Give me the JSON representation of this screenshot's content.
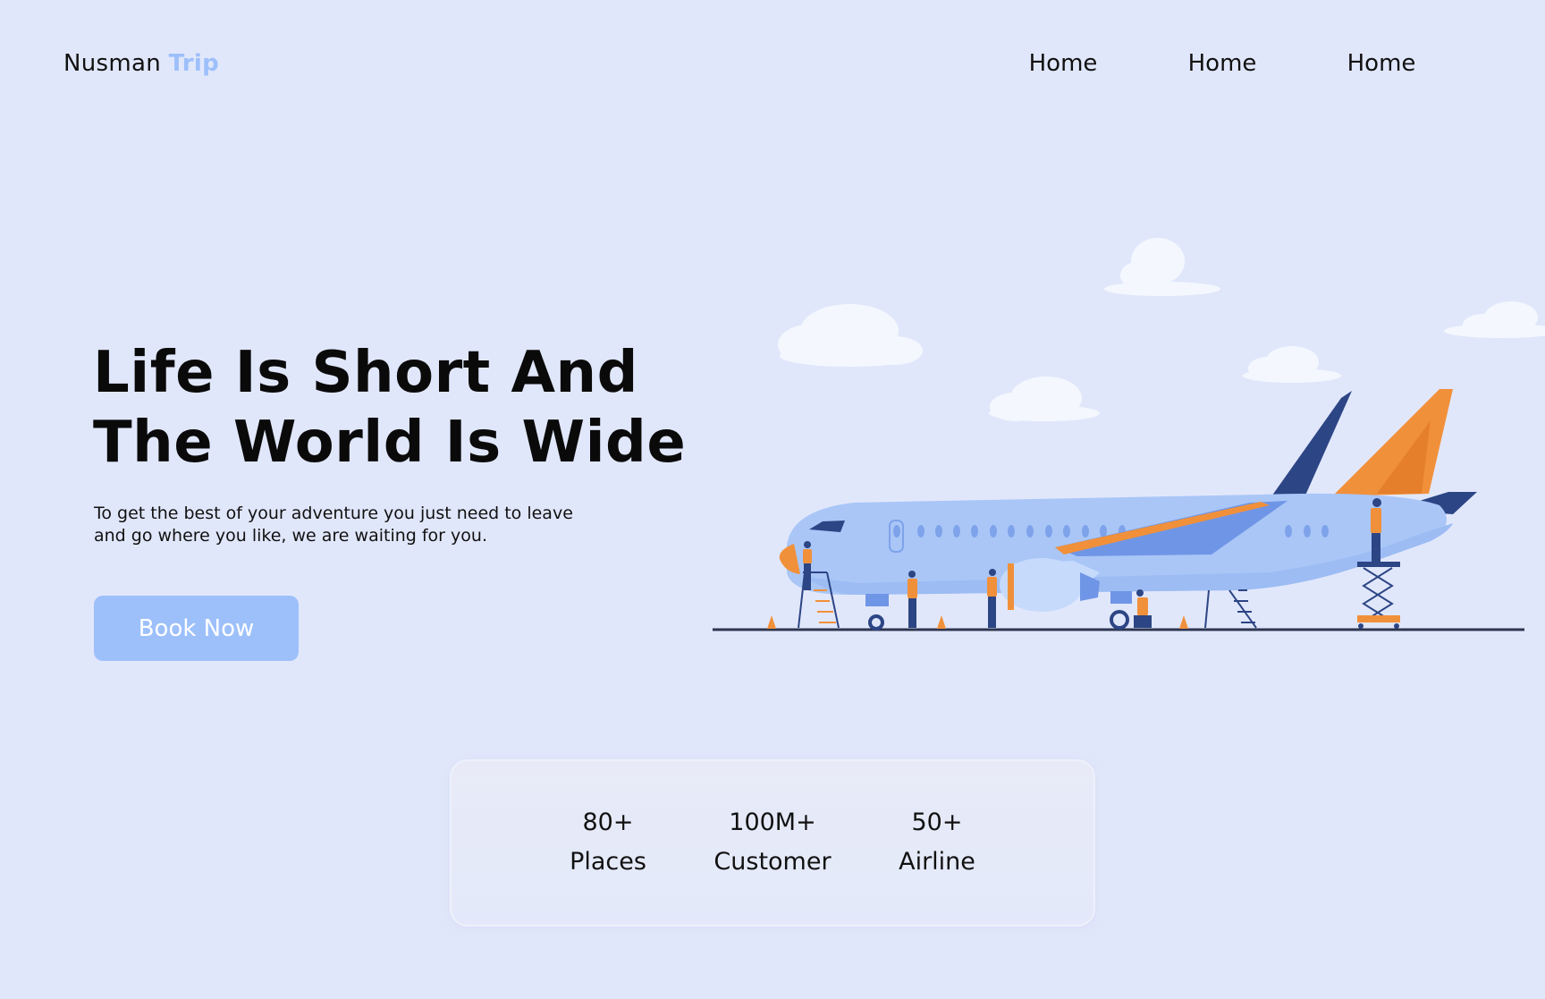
{
  "header": {
    "logo_main": "Nusman",
    "logo_accent": "Trip",
    "nav": [
      "Home",
      "Home",
      "Home"
    ]
  },
  "hero": {
    "headline_line1": "Life Is Short And",
    "headline_line2": "The World Is Wide",
    "subtext_line1": "To get the best of your adventure you just need to leave",
    "subtext_line2": "and go where you like, we are waiting for you.",
    "cta_label": "Book Now"
  },
  "stats": [
    {
      "value": "80+",
      "label": "Places"
    },
    {
      "value": "100M+",
      "label": "Customer"
    },
    {
      "value": "50+",
      "label": "Airline"
    }
  ],
  "colors": {
    "background": "#e1e7fb",
    "accent": "#9dc0fb",
    "plane_body": "#a9c6f7",
    "plane_dark": "#2c4585",
    "plane_orange": "#f1903a"
  }
}
